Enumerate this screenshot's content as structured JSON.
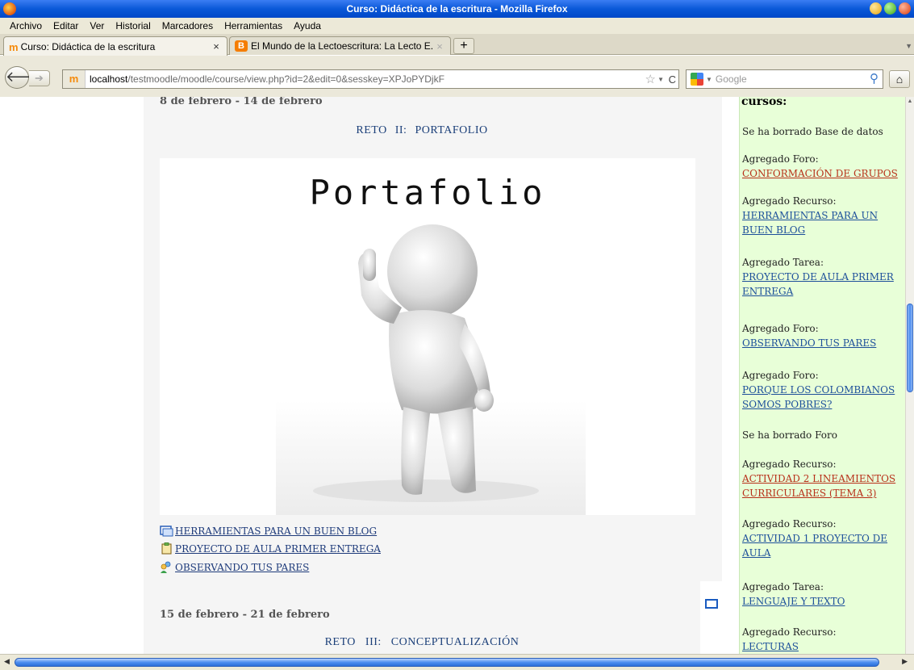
{
  "window": {
    "title": "Curso: Didáctica de la escritura - Mozilla Firefox"
  },
  "menu": [
    "Archivo",
    "Editar",
    "Ver",
    "Historial",
    "Marcadores",
    "Herramientas",
    "Ayuda"
  ],
  "tabs": [
    {
      "label": "Curso: Didáctica de la escritura",
      "close": "×"
    },
    {
      "label": "El Mundo de la Lectoescritura: La Lecto E...",
      "close": "×"
    }
  ],
  "new_tab": "+",
  "nav": {
    "url_host": "localhost",
    "url_rest": "/testmoodle/moodle/course/view.php?id=2&edit=0&sesskey=XPJoPYDjkF",
    "search_placeholder": "Google"
  },
  "section1": {
    "dates": "8 de febrero - 14 de febrero",
    "reto_word": "RETO",
    "reto_num": "II:",
    "reto_title": "PORTAFOLIO",
    "image_title": "Portafolio",
    "links": [
      "HERRAMIENTAS PARA UN BUEN BLOG",
      "PROYECTO DE AULA PRIMER ENTREGA",
      "OBSERVANDO TUS PARES"
    ]
  },
  "section2": {
    "dates": "15 de febrero - 21 de febrero",
    "reto_word": "RETO",
    "reto_num": "III:",
    "reto_title": "CONCEPTUALIZACIÓN"
  },
  "recent": {
    "heading": "cursos:",
    "items": [
      {
        "text": "Se ha borrado Base de datos"
      },
      {
        "text": "Agregado Foro:",
        "link": "CONFORMACIÓN DE GRUPOS"
      },
      {
        "text": "Agregado Recurso:",
        "link": "HERRAMIENTAS PARA UN BUEN BLOG"
      },
      {
        "text": "Agregado Tarea:",
        "link": "PROYECTO DE AULA PRIMER ENTREGA"
      },
      {
        "text": "Agregado Foro:",
        "link": "OBSERVANDO TUS PARES"
      },
      {
        "text": "Agregado Foro:",
        "link": "PORQUE LOS COLOMBIANOS SOMOS POBRES?"
      },
      {
        "text": "Se ha borrado Foro"
      },
      {
        "text": "Agregado Recurso:",
        "link": "ACTIVIDAD 2 LINEAMIENTOS CURRICULARES (TEMA 3)"
      },
      {
        "text": "Agregado Recurso:",
        "link": "ACTIVIDAD 1 PROYECTO DE AULA"
      },
      {
        "text": "Agregado Tarea:",
        "link": "LENGUAJE Y TEXTO"
      },
      {
        "text": "Agregado Recurso:",
        "link": "LECTURAS"
      }
    ]
  },
  "colors": {
    "link_blue": "#1d4f9a",
    "link_red": "#b8301a",
    "block_green": "#e8ffd8"
  }
}
